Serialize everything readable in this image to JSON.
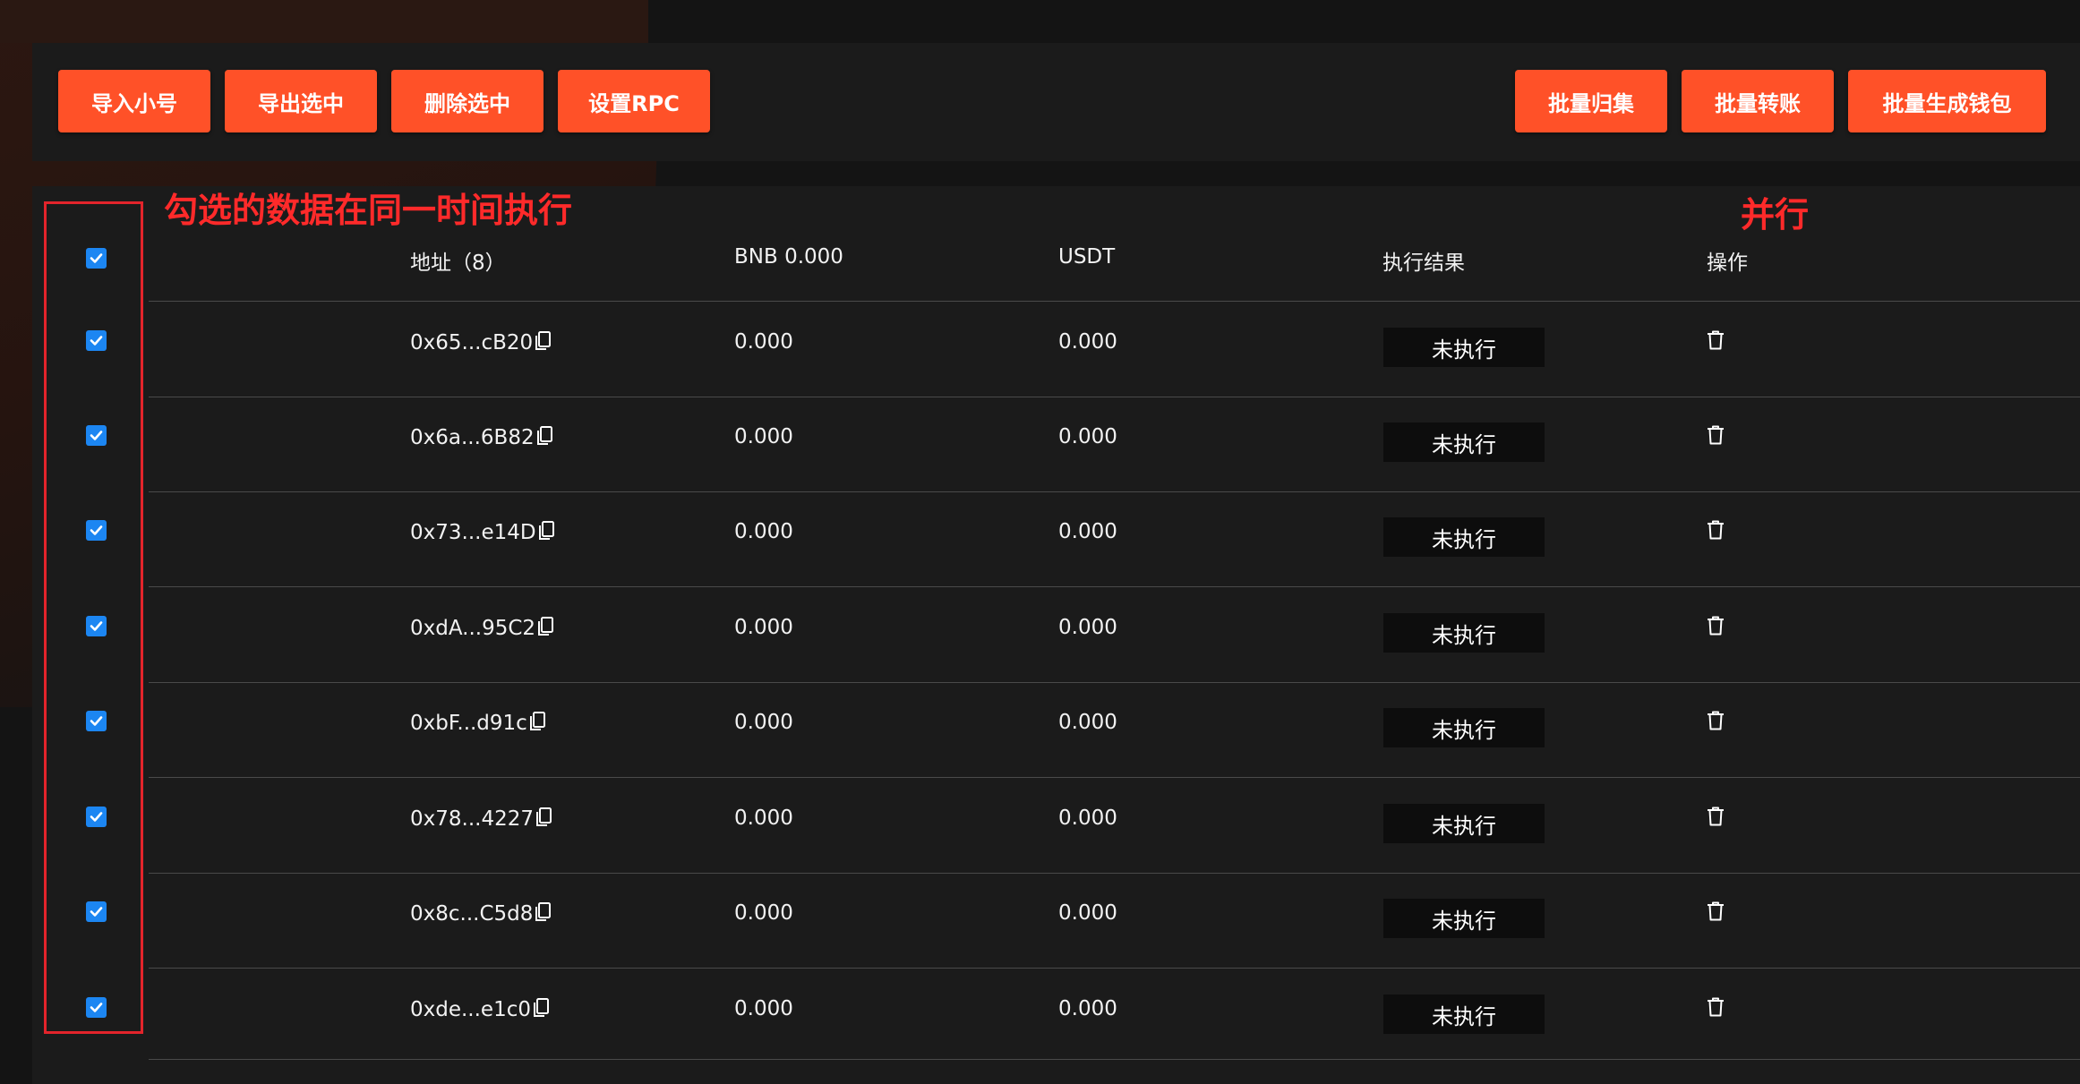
{
  "toolbar": {
    "left_buttons": [
      "导入小号",
      "导出选中",
      "删除选中",
      "设置RPC"
    ],
    "right_buttons": [
      "批量归集",
      "批量转账",
      "批量生成钱包"
    ]
  },
  "table": {
    "headers": {
      "address": "地址（8）",
      "bnb": "BNB 0.000",
      "usdt": "USDT",
      "result": "执行结果",
      "action": "操作"
    },
    "header_checked": true,
    "rows": [
      {
        "address": "0x65...cB20",
        "bnb": "0.000",
        "usdt": "0.000",
        "status": "未执行",
        "checked": true
      },
      {
        "address": "0x6a...6B82",
        "bnb": "0.000",
        "usdt": "0.000",
        "status": "未执行",
        "checked": true
      },
      {
        "address": "0x73...e14D",
        "bnb": "0.000",
        "usdt": "0.000",
        "status": "未执行",
        "checked": true
      },
      {
        "address": "0xdA...95C2",
        "bnb": "0.000",
        "usdt": "0.000",
        "status": "未执行",
        "checked": true
      },
      {
        "address": "0xbF...d91c",
        "bnb": "0.000",
        "usdt": "0.000",
        "status": "未执行",
        "checked": true
      },
      {
        "address": "0x78...4227",
        "bnb": "0.000",
        "usdt": "0.000",
        "status": "未执行",
        "checked": true
      },
      {
        "address": "0x8c...C5d8",
        "bnb": "0.000",
        "usdt": "0.000",
        "status": "未执行",
        "checked": true
      },
      {
        "address": "0xde...e1c0",
        "bnb": "0.000",
        "usdt": "0.000",
        "status": "未执行",
        "checked": true
      }
    ]
  },
  "annotations": {
    "checkbox_note": "勾选的数据在同一时间执行",
    "parallel_note": "并行"
  },
  "colors": {
    "accent": "#ff5128",
    "checkbox": "#1c86f2",
    "annotation": "#ff2a2a"
  },
  "icons": {
    "copy": "copy-icon",
    "delete": "trash-icon",
    "check": "check-icon"
  }
}
